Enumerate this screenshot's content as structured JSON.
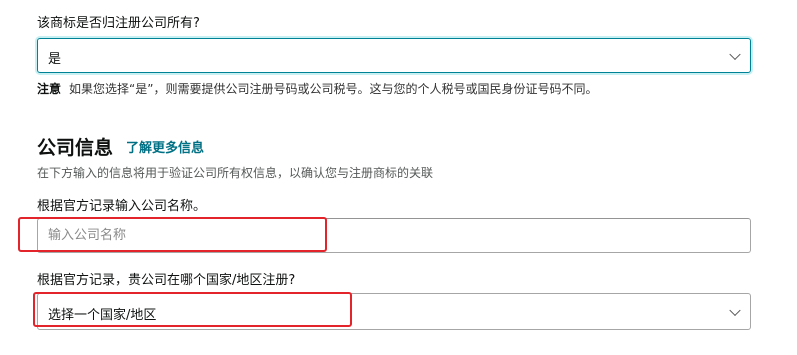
{
  "ownership_question": {
    "label": "该商标是否归注册公司所有?",
    "selected_value": "是"
  },
  "note": {
    "label": "注意",
    "text": "如果您选择“是”，则需要提供公司注册号码或公司税号。这与您的个人税号或国民身份证号码不同。"
  },
  "company_info": {
    "title": "公司信息",
    "learn_more": "了解更多信息",
    "description": "在下方输入的信息将用于验证公司所有权信息，以确认您与注册商标的关联"
  },
  "company_name": {
    "label": "根据官方记录输入公司名称。",
    "placeholder": "输入公司名称",
    "value": ""
  },
  "country_question": {
    "label": "根据官方记录，贵公司在哪个国家/地区注册?",
    "selected_value": "选择一个国家/地区"
  },
  "colors": {
    "accent": "#007185",
    "focus_border": "#008296",
    "annotation_red": "#e3242b"
  }
}
